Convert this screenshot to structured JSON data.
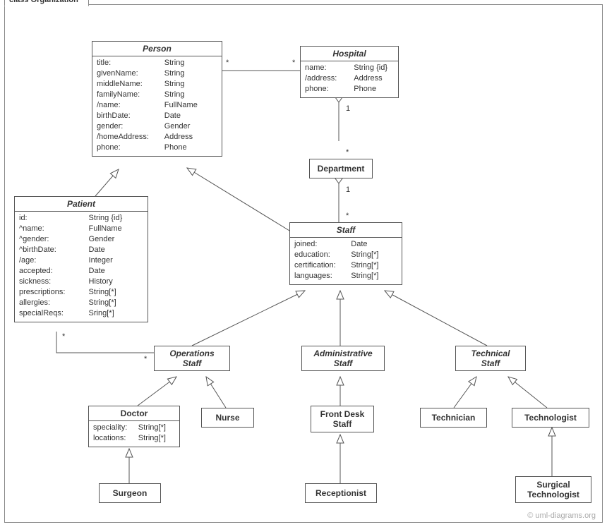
{
  "frame_title": "class Organization",
  "watermark": "© uml-diagrams.org",
  "classes": {
    "person": {
      "name": "Person",
      "attrs": [
        {
          "k": "title:",
          "v": "String"
        },
        {
          "k": "givenName:",
          "v": "String"
        },
        {
          "k": "middleName:",
          "v": "String"
        },
        {
          "k": "familyName:",
          "v": "String"
        },
        {
          "k": "/name:",
          "v": "FullName"
        },
        {
          "k": "birthDate:",
          "v": "Date"
        },
        {
          "k": "gender:",
          "v": "Gender"
        },
        {
          "k": "/homeAddress:",
          "v": "Address"
        },
        {
          "k": "phone:",
          "v": "Phone"
        }
      ]
    },
    "hospital": {
      "name": "Hospital",
      "attrs": [
        {
          "k": "name:",
          "v": "String {id}"
        },
        {
          "k": "/address:",
          "v": "Address"
        },
        {
          "k": "phone:",
          "v": "Phone"
        }
      ]
    },
    "department": {
      "name": "Department"
    },
    "patient": {
      "name": "Patient",
      "attrs": [
        {
          "k": "id:",
          "v": "String {id}"
        },
        {
          "k": "^name:",
          "v": "FullName"
        },
        {
          "k": "^gender:",
          "v": "Gender"
        },
        {
          "k": "^birthDate:",
          "v": "Date"
        },
        {
          "k": "/age:",
          "v": "Integer"
        },
        {
          "k": "accepted:",
          "v": "Date"
        },
        {
          "k": "sickness:",
          "v": "History"
        },
        {
          "k": "prescriptions:",
          "v": "String[*]"
        },
        {
          "k": "allergies:",
          "v": "String[*]"
        },
        {
          "k": "specialReqs:",
          "v": "Sring[*]"
        }
      ]
    },
    "staff": {
      "name": "Staff",
      "attrs": [
        {
          "k": "joined:",
          "v": "Date"
        },
        {
          "k": "education:",
          "v": "String[*]"
        },
        {
          "k": "certification:",
          "v": "String[*]"
        },
        {
          "k": "languages:",
          "v": "String[*]"
        }
      ]
    },
    "ops_staff": {
      "name_l1": "Operations",
      "name_l2": "Staff"
    },
    "admin_staff": {
      "name_l1": "Administrative",
      "name_l2": "Staff"
    },
    "tech_staff": {
      "name_l1": "Technical",
      "name_l2": "Staff"
    },
    "doctor": {
      "name": "Doctor",
      "attrs": [
        {
          "k": "speciality:",
          "v": "String[*]"
        },
        {
          "k": "locations:",
          "v": "String[*]"
        }
      ]
    },
    "nurse": {
      "name": "Nurse"
    },
    "front_desk": {
      "name_l1": "Front Desk",
      "name_l2": "Staff"
    },
    "technician": {
      "name": "Technician"
    },
    "technologist": {
      "name": "Technologist"
    },
    "surgeon": {
      "name": "Surgeon"
    },
    "receptionist": {
      "name": "Receptionist"
    },
    "surgical_tech": {
      "name_l1": "Surgical",
      "name_l2": "Technologist"
    }
  },
  "mults": {
    "person_hosp_l": "*",
    "person_hosp_r": "*",
    "hosp_dept_top": "1",
    "hosp_dept_bot": "*",
    "dept_staff_top": "1",
    "dept_staff_bot": "*",
    "patient_ops_l": "*",
    "patient_ops_r": "*"
  }
}
